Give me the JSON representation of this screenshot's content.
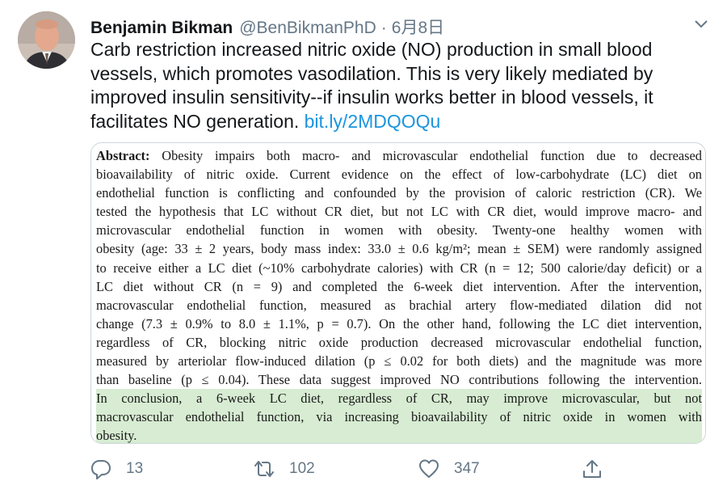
{
  "tweet": {
    "author_name": "Benjamin Bikman",
    "handle": "@BenBikmanPhD",
    "separator": "·",
    "date": "6月8日",
    "text": "Carb restriction increased nitric oxide (NO) production in small blood vessels, which promotes vasodilation. This is very likely mediated by improved insulin sensitivity--if insulin works better in blood vessels, it facilitates NO generation. ",
    "link": "bit.ly/2MDQOQu"
  },
  "abstract": {
    "label": "Abstract:",
    "lines": [
      " Obesity impairs both macro- and microvascular endothelial function due to decreased",
      "bioavailability of nitric oxide. Current evidence on the effect of low-carbohydrate (LC) diet on",
      "endothelial function is conflicting and confounded by the provision of caloric restriction (CR). We",
      "tested the hypothesis that LC without CR diet, but not LC with CR diet, would improve macro- and",
      "microvascular endothelial function in women with obesity. Twenty-one healthy women with",
      "obesity (age: 33 ± 2 years, body mass index: 33.0 ± 0.6 kg/m²; mean ± SEM) were randomly assigned",
      "to receive either a LC diet (~10% carbohydrate calories) with CR (n = 12; 500 calorie/day deficit) or a",
      "LC diet without CR (n = 9) and completed the 6-week diet intervention. After the intervention,",
      "macrovascular endothelial function, measured as brachial artery flow-mediated dilation did not",
      "change (7.3 ± 0.9% to 8.0 ± 1.1%, p = 0.7). On the other hand, following the LC diet intervention,",
      "regardless of CR, blocking nitric oxide production decreased microvascular endothelial function,",
      "measured by arteriolar flow-induced dilation (p ≤ 0.02 for both diets) and the magnitude was more",
      "than baseline (p ≤ 0.04). These data suggest improved NO contributions following the intervention."
    ],
    "highlighted_lines": [
      "In conclusion, a 6-week LC diet, regardless of CR, may improve microvascular, but not",
      "macrovascular endothelial function, via increasing bioavailability of nitric oxide in women with",
      "obesity."
    ],
    "highlight_color": "#d7ecd2"
  },
  "actions": {
    "reply_count": "13",
    "retweet_count": "102",
    "like_count": "347"
  },
  "colors": {
    "text": "#14171a",
    "secondary": "#657786",
    "link": "#1b95e0",
    "border": "#ccd6dd"
  }
}
